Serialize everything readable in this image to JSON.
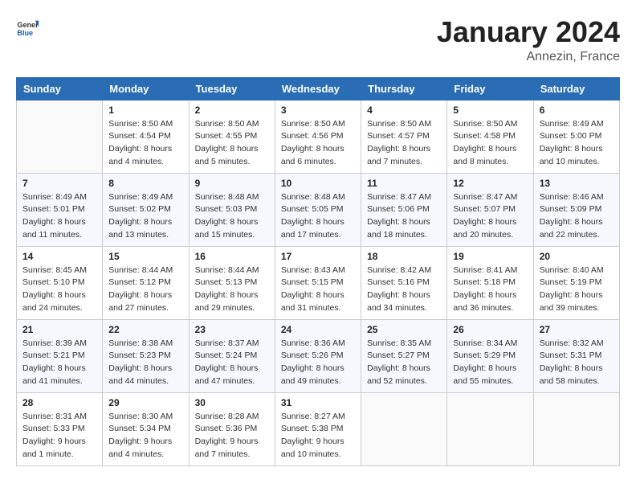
{
  "header": {
    "logo_general": "General",
    "logo_blue": "Blue",
    "month": "January 2024",
    "location": "Annezin, France"
  },
  "days_of_week": [
    "Sunday",
    "Monday",
    "Tuesday",
    "Wednesday",
    "Thursday",
    "Friday",
    "Saturday"
  ],
  "weeks": [
    [
      {
        "day": "",
        "sunrise": "",
        "sunset": "",
        "daylight": ""
      },
      {
        "day": "1",
        "sunrise": "Sunrise: 8:50 AM",
        "sunset": "Sunset: 4:54 PM",
        "daylight": "Daylight: 8 hours and 4 minutes."
      },
      {
        "day": "2",
        "sunrise": "Sunrise: 8:50 AM",
        "sunset": "Sunset: 4:55 PM",
        "daylight": "Daylight: 8 hours and 5 minutes."
      },
      {
        "day": "3",
        "sunrise": "Sunrise: 8:50 AM",
        "sunset": "Sunset: 4:56 PM",
        "daylight": "Daylight: 8 hours and 6 minutes."
      },
      {
        "day": "4",
        "sunrise": "Sunrise: 8:50 AM",
        "sunset": "Sunset: 4:57 PM",
        "daylight": "Daylight: 8 hours and 7 minutes."
      },
      {
        "day": "5",
        "sunrise": "Sunrise: 8:50 AM",
        "sunset": "Sunset: 4:58 PM",
        "daylight": "Daylight: 8 hours and 8 minutes."
      },
      {
        "day": "6",
        "sunrise": "Sunrise: 8:49 AM",
        "sunset": "Sunset: 5:00 PM",
        "daylight": "Daylight: 8 hours and 10 minutes."
      }
    ],
    [
      {
        "day": "7",
        "sunrise": "Sunrise: 8:49 AM",
        "sunset": "Sunset: 5:01 PM",
        "daylight": "Daylight: 8 hours and 11 minutes."
      },
      {
        "day": "8",
        "sunrise": "Sunrise: 8:49 AM",
        "sunset": "Sunset: 5:02 PM",
        "daylight": "Daylight: 8 hours and 13 minutes."
      },
      {
        "day": "9",
        "sunrise": "Sunrise: 8:48 AM",
        "sunset": "Sunset: 5:03 PM",
        "daylight": "Daylight: 8 hours and 15 minutes."
      },
      {
        "day": "10",
        "sunrise": "Sunrise: 8:48 AM",
        "sunset": "Sunset: 5:05 PM",
        "daylight": "Daylight: 8 hours and 17 minutes."
      },
      {
        "day": "11",
        "sunrise": "Sunrise: 8:47 AM",
        "sunset": "Sunset: 5:06 PM",
        "daylight": "Daylight: 8 hours and 18 minutes."
      },
      {
        "day": "12",
        "sunrise": "Sunrise: 8:47 AM",
        "sunset": "Sunset: 5:07 PM",
        "daylight": "Daylight: 8 hours and 20 minutes."
      },
      {
        "day": "13",
        "sunrise": "Sunrise: 8:46 AM",
        "sunset": "Sunset: 5:09 PM",
        "daylight": "Daylight: 8 hours and 22 minutes."
      }
    ],
    [
      {
        "day": "14",
        "sunrise": "Sunrise: 8:45 AM",
        "sunset": "Sunset: 5:10 PM",
        "daylight": "Daylight: 8 hours and 24 minutes."
      },
      {
        "day": "15",
        "sunrise": "Sunrise: 8:44 AM",
        "sunset": "Sunset: 5:12 PM",
        "daylight": "Daylight: 8 hours and 27 minutes."
      },
      {
        "day": "16",
        "sunrise": "Sunrise: 8:44 AM",
        "sunset": "Sunset: 5:13 PM",
        "daylight": "Daylight: 8 hours and 29 minutes."
      },
      {
        "day": "17",
        "sunrise": "Sunrise: 8:43 AM",
        "sunset": "Sunset: 5:15 PM",
        "daylight": "Daylight: 8 hours and 31 minutes."
      },
      {
        "day": "18",
        "sunrise": "Sunrise: 8:42 AM",
        "sunset": "Sunset: 5:16 PM",
        "daylight": "Daylight: 8 hours and 34 minutes."
      },
      {
        "day": "19",
        "sunrise": "Sunrise: 8:41 AM",
        "sunset": "Sunset: 5:18 PM",
        "daylight": "Daylight: 8 hours and 36 minutes."
      },
      {
        "day": "20",
        "sunrise": "Sunrise: 8:40 AM",
        "sunset": "Sunset: 5:19 PM",
        "daylight": "Daylight: 8 hours and 39 minutes."
      }
    ],
    [
      {
        "day": "21",
        "sunrise": "Sunrise: 8:39 AM",
        "sunset": "Sunset: 5:21 PM",
        "daylight": "Daylight: 8 hours and 41 minutes."
      },
      {
        "day": "22",
        "sunrise": "Sunrise: 8:38 AM",
        "sunset": "Sunset: 5:23 PM",
        "daylight": "Daylight: 8 hours and 44 minutes."
      },
      {
        "day": "23",
        "sunrise": "Sunrise: 8:37 AM",
        "sunset": "Sunset: 5:24 PM",
        "daylight": "Daylight: 8 hours and 47 minutes."
      },
      {
        "day": "24",
        "sunrise": "Sunrise: 8:36 AM",
        "sunset": "Sunset: 5:26 PM",
        "daylight": "Daylight: 8 hours and 49 minutes."
      },
      {
        "day": "25",
        "sunrise": "Sunrise: 8:35 AM",
        "sunset": "Sunset: 5:27 PM",
        "daylight": "Daylight: 8 hours and 52 minutes."
      },
      {
        "day": "26",
        "sunrise": "Sunrise: 8:34 AM",
        "sunset": "Sunset: 5:29 PM",
        "daylight": "Daylight: 8 hours and 55 minutes."
      },
      {
        "day": "27",
        "sunrise": "Sunrise: 8:32 AM",
        "sunset": "Sunset: 5:31 PM",
        "daylight": "Daylight: 8 hours and 58 minutes."
      }
    ],
    [
      {
        "day": "28",
        "sunrise": "Sunrise: 8:31 AM",
        "sunset": "Sunset: 5:33 PM",
        "daylight": "Daylight: 9 hours and 1 minute."
      },
      {
        "day": "29",
        "sunrise": "Sunrise: 8:30 AM",
        "sunset": "Sunset: 5:34 PM",
        "daylight": "Daylight: 9 hours and 4 minutes."
      },
      {
        "day": "30",
        "sunrise": "Sunrise: 8:28 AM",
        "sunset": "Sunset: 5:36 PM",
        "daylight": "Daylight: 9 hours and 7 minutes."
      },
      {
        "day": "31",
        "sunrise": "Sunrise: 8:27 AM",
        "sunset": "Sunset: 5:38 PM",
        "daylight": "Daylight: 9 hours and 10 minutes."
      },
      {
        "day": "",
        "sunrise": "",
        "sunset": "",
        "daylight": ""
      },
      {
        "day": "",
        "sunrise": "",
        "sunset": "",
        "daylight": ""
      },
      {
        "day": "",
        "sunrise": "",
        "sunset": "",
        "daylight": ""
      }
    ]
  ]
}
